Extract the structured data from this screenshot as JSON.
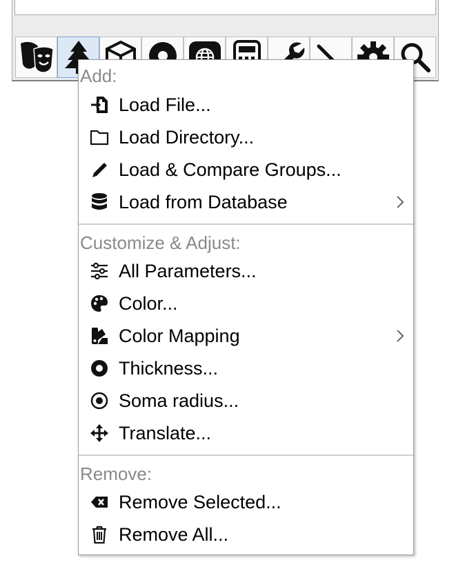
{
  "menu": {
    "sections": [
      {
        "title": "Add:",
        "items": [
          {
            "label": "Load File...",
            "icon": "file-import-icon"
          },
          {
            "label": "Load Directory...",
            "icon": "folder-icon"
          },
          {
            "label": "Load & Compare Groups...",
            "icon": "pen-icon"
          },
          {
            "label": "Load from Database",
            "icon": "database-icon",
            "submenu": true
          }
        ]
      },
      {
        "title": "Customize & Adjust:",
        "items": [
          {
            "label": "All Parameters...",
            "icon": "sliders-icon"
          },
          {
            "label": "Color...",
            "icon": "palette-icon"
          },
          {
            "label": "Color Mapping",
            "icon": "swatchbook-icon",
            "submenu": true
          },
          {
            "label": "Thickness...",
            "icon": "circle-ring-icon"
          },
          {
            "label": "Soma radius...",
            "icon": "dot-circle-icon"
          },
          {
            "label": "Translate...",
            "icon": "arrows-move-icon"
          }
        ]
      },
      {
        "title": "Remove:",
        "items": [
          {
            "label": "Remove Selected...",
            "icon": "backspace-icon"
          },
          {
            "label": "Remove All...",
            "icon": "trash-icon"
          }
        ]
      }
    ]
  },
  "toolbar": {
    "buttons": [
      {
        "icon": "theater-masks-icon"
      },
      {
        "icon": "tree-icon",
        "selected": true
      },
      {
        "icon": "cube-icon"
      },
      {
        "icon": "user-circle-icon"
      },
      {
        "icon": "globe-icon"
      },
      {
        "icon": "calculator-icon"
      },
      {
        "icon": "wrench-icon"
      },
      {
        "icon": "pencil-tool-icon"
      },
      {
        "icon": "gear-icon"
      },
      {
        "icon": "search-icon"
      }
    ]
  }
}
